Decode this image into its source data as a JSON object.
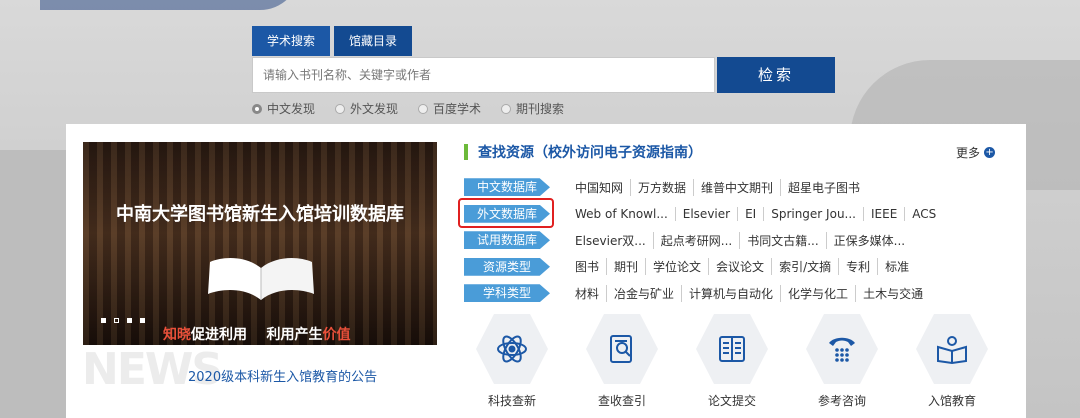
{
  "search": {
    "tabs": [
      "学术搜索",
      "馆藏目录"
    ],
    "placeholder": "请输入书刊名称、关键字或作者",
    "button": "检索",
    "options": [
      "中文发现",
      "外文发现",
      "百度学术",
      "期刊搜索"
    ],
    "selected_option": "中文发现"
  },
  "banner": {
    "title": "中南大学图书馆新生入馆培训数据库",
    "slogan_hl1": "知晓",
    "slogan_mid": "促进利用",
    "slogan_part3": "利用产生",
    "slogan_hl2": "价值"
  },
  "news": {
    "watermark": "NEWS",
    "link": "2020级本科新生入馆教育的公告"
  },
  "resources": {
    "title": "查找资源（校外访问电子资源指南）",
    "more": "更多",
    "rows": [
      {
        "category": "中文数据库",
        "items": [
          "中国知网",
          "万方数据",
          "维普中文期刊",
          "超星电子图书"
        ]
      },
      {
        "category": "外文数据库",
        "items": [
          "Web of Knowl...",
          "Elsevier",
          "EI",
          "Springer Jou...",
          "IEEE",
          "ACS"
        ]
      },
      {
        "category": "试用数据库",
        "items": [
          "Elsevier双...",
          "起点考研网...",
          "书同文古籍...",
          "正保多媒体..."
        ]
      },
      {
        "category": "资源类型",
        "items": [
          "图书",
          "期刊",
          "学位论文",
          "会议论文",
          "索引/文摘",
          "专利",
          "标准"
        ]
      },
      {
        "category": "学科类型",
        "items": [
          "材料",
          "冶金与矿业",
          "计算机与自动化",
          "化学与化工",
          "土木与交通"
        ]
      }
    ]
  },
  "services": [
    {
      "label": "科技查新",
      "icon": "atom-icon"
    },
    {
      "label": "查收查引",
      "icon": "document-search-icon"
    },
    {
      "label": "论文提交",
      "icon": "open-book-icon"
    },
    {
      "label": "参考咨询",
      "icon": "telephone-icon"
    },
    {
      "label": "入馆教育",
      "icon": "reading-person-icon"
    }
  ],
  "colors": {
    "primary": "#1c58a6",
    "category": "#4a9cd8",
    "highlight": "#e02020",
    "accent": "#6cba3a"
  }
}
